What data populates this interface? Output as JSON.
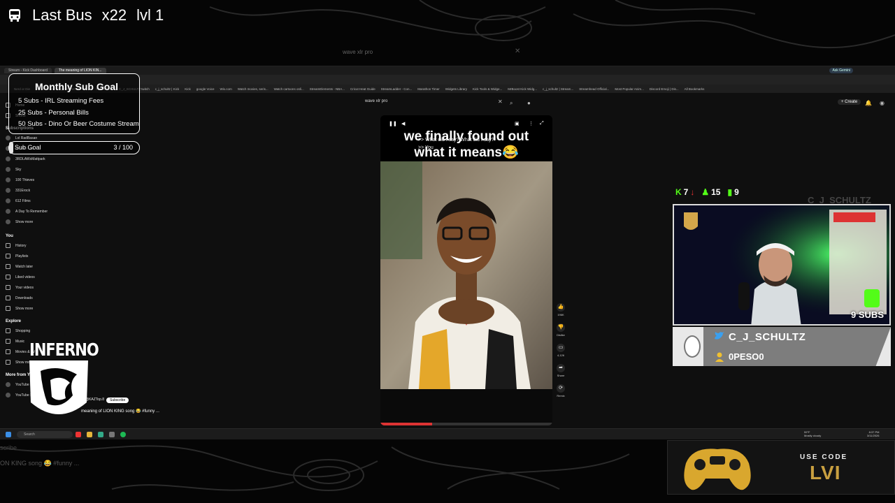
{
  "overlay": {
    "title": "Last Bus",
    "multiplier": "x22",
    "level": "lvl 1",
    "ghost_search": "wave xlr pro",
    "ghost_bottom": "ON KING song 😂 #funny ...",
    "ghost_bottom2": "scribe"
  },
  "browser": {
    "tabs": [
      "Stream - Kick Dashboard",
      "The meaning of LION KIN..."
    ],
    "ask_label": "Ask Gemini",
    "bookmarks": [
      "Nerd or Die",
      "Switch Items",
      "Spin the Wheel - Ra...",
      "Switch Items",
      "C_J_SCHULTZ twitch",
      "c_j_schultz | Kick",
      "Kick",
      "google Voice",
      "Wix.com",
      "Watch movies, seris...",
      "Watch cartoons onli...",
      "StreamElements - NBA...",
      "Cricut Heat Guide",
      "StreamLadder - Con...",
      "Marathon Timer",
      "Widgets Library",
      "Kick Tools & Widge...",
      "MrBoost Kick Widg...",
      "c_j_schultz | Stream...",
      "Streamhead Official...",
      "Most Popular Anim...",
      "Discord Emoji | Dis...",
      "All Bookmarks"
    ]
  },
  "youtube": {
    "search_value": "wave xlr pro",
    "create_label": "+ Create",
    "sidebar": {
      "top_items": [
        "Home",
        "Shorts"
      ],
      "subscriptions_label": "Subscriptions",
      "subscriptions": [
        "Lvl RadBasan",
        "3D Pen Lab",
        "3RDLAWsMattpark",
        "Sky",
        "100 Thieves",
        "331Erock",
        "612 Films",
        "A Day To Remember",
        "Show more"
      ],
      "you_label": "You",
      "you_items": [
        "History",
        "Playlists",
        "Watch later",
        "Liked videos",
        "Your videos",
        "Downloads",
        "Show more"
      ],
      "explore_label": "Explore",
      "explore_items": [
        "Shopping",
        "Music",
        "Movies & TV",
        "Show more"
      ],
      "more_label": "More from YouTube",
      "more_items": [
        "YouTube Premium",
        "YouTube Studio"
      ]
    },
    "short": {
      "caption_line1": "we finally found out",
      "caption_line2": "what it means😂",
      "subtitle_line1": ">> What did I say? What did I say?",
      "subtitle_line2": ">> You",
      "title": "meaning of LION KING song 😂 #funny ...",
      "channel": "@KAZTop.8",
      "subscribe_label": "Subscribe",
      "actions": [
        {
          "icon": "like-icon",
          "label": "196K"
        },
        {
          "icon": "dislike-icon",
          "label": "Dislike"
        },
        {
          "icon": "comment-icon",
          "label": "4,126"
        },
        {
          "icon": "share-icon",
          "label": "Share"
        },
        {
          "icon": "remix-icon",
          "label": "Remix"
        }
      ]
    }
  },
  "taskbar": {
    "search_label": "Search",
    "weather_temp": "59°F",
    "weather_desc": "Mostly cloudy",
    "time": "8:37 PM",
    "date": "3/11/2026"
  },
  "sub_goal": {
    "heading": "Monthly Sub Goal",
    "lines": [
      "5 Subs - IRL Streaming Fees",
      "25 Subs - Personal Bills",
      "50 Subs - Dino Or Beer Costume Stream"
    ],
    "bar_label": "Sub Goal",
    "bar_value": "3 / 100",
    "progress": 0.03
  },
  "logo": {
    "text": "INFERNO"
  },
  "stream_stats": {
    "kick_followers": "7",
    "new_followers": "15",
    "viewers": "9"
  },
  "cam": {
    "ghost_name": "C_J_SCHULTZ",
    "subs_badge": "9 SUBS",
    "handle": "C_J_SCHULTZ",
    "viewer_name": "0PESO0"
  },
  "promo": {
    "use_code": "USE CODE",
    "code": "LVI"
  },
  "colors": {
    "kick_green": "#53fc18",
    "gold": "#c9a040",
    "down_red": "#e33333"
  }
}
